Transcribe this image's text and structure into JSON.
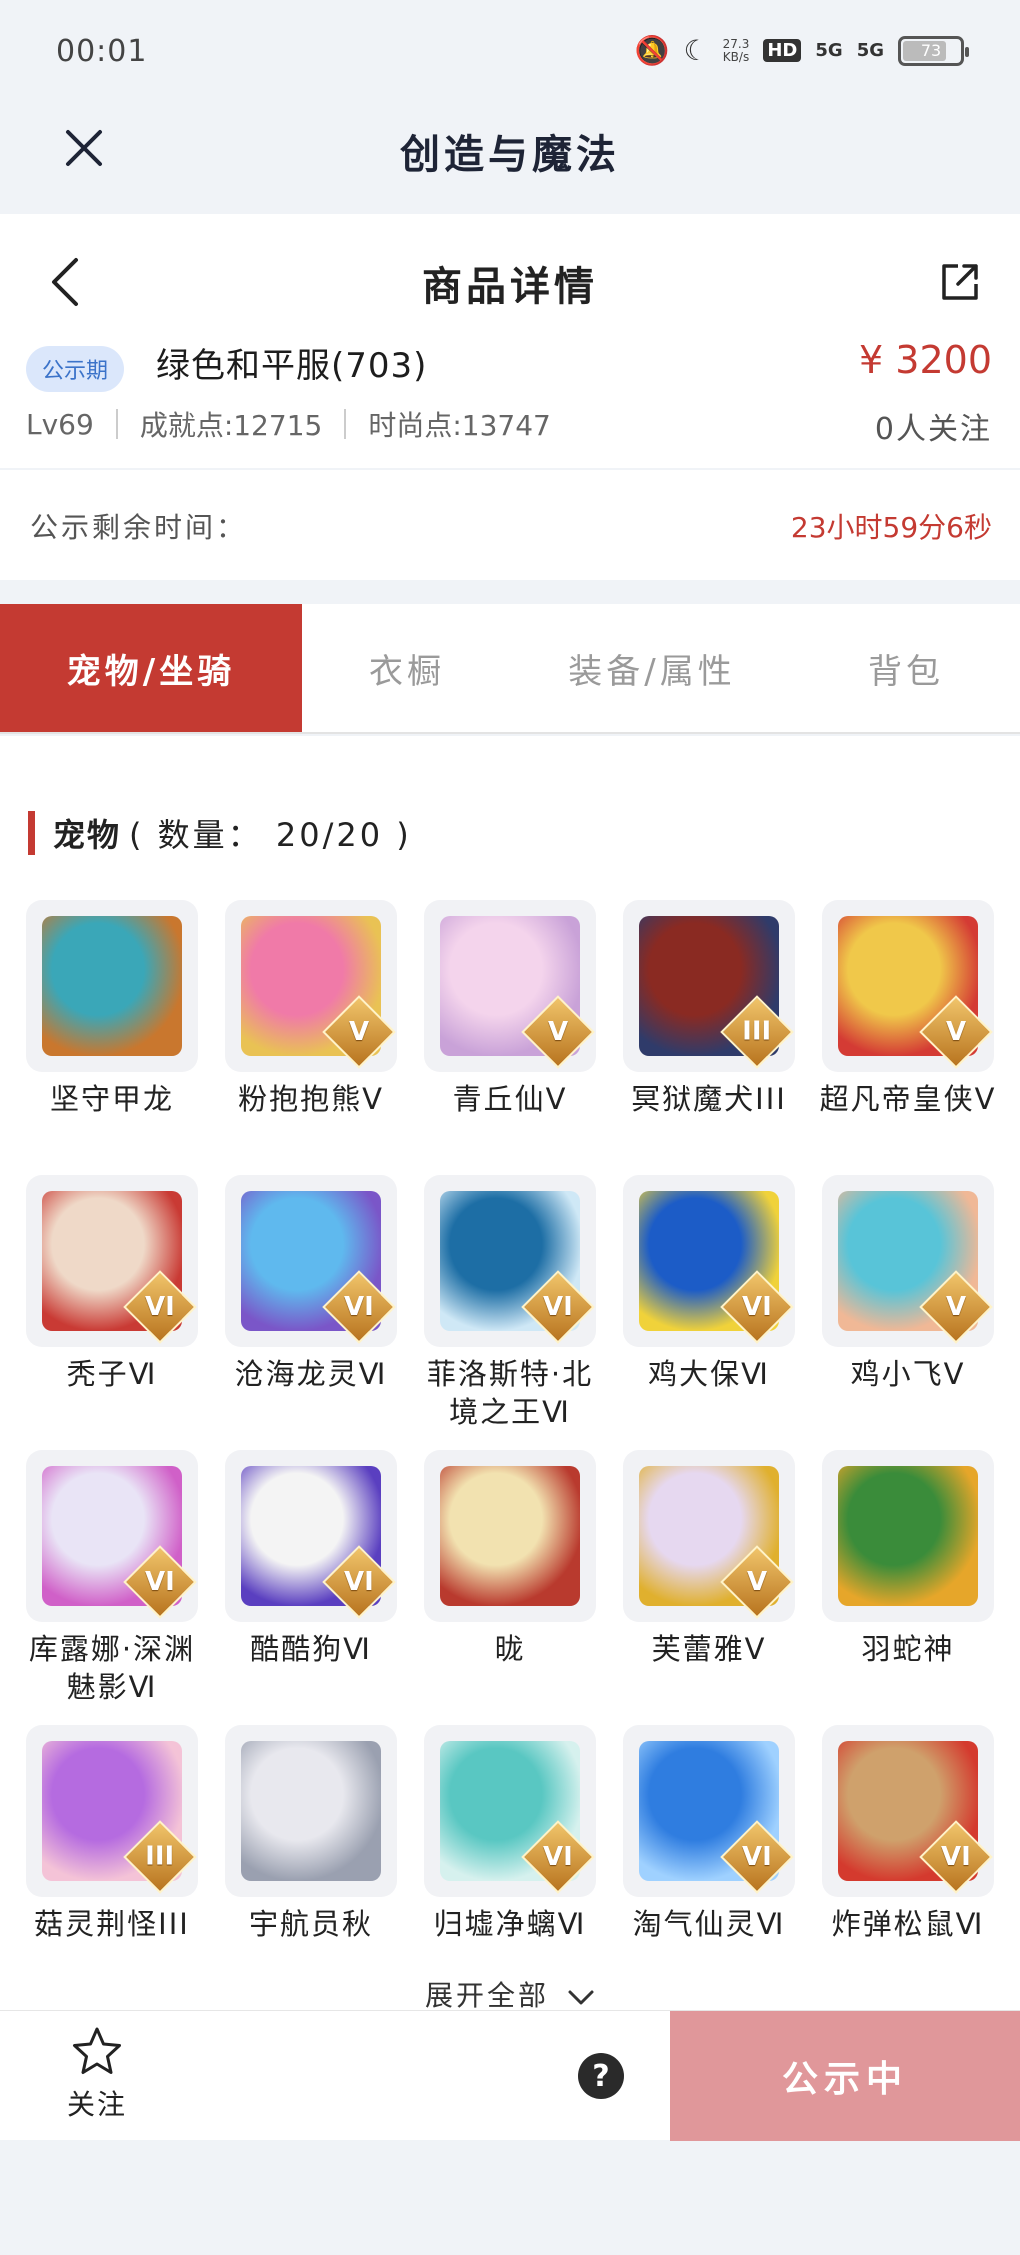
{
  "status_bar": {
    "time": "00:01",
    "net_speed_value": "27.3",
    "net_speed_unit": "KB/s",
    "hd_label": "HD",
    "signal1": "5G",
    "signal2": "5G",
    "battery": "73",
    "icons": [
      "mute-icon",
      "moon-icon"
    ]
  },
  "app_bar": {
    "title": "创造与魔法"
  },
  "nav": {
    "title": "商品详情"
  },
  "product": {
    "badge": "公示期",
    "name": "绿色和平服(703)",
    "price": "¥ 3200",
    "level": "Lv69",
    "achievement": "成就点:12715",
    "fashion": "时尚点:13747",
    "followers": "0人关注"
  },
  "countdown": {
    "label": "公示剩余时间：",
    "value": "23小时59分6秒"
  },
  "tabs": [
    {
      "label": "宠物/坐骑",
      "active": true
    },
    {
      "label": "衣橱",
      "active": false
    },
    {
      "label": "装备/属性",
      "active": false
    },
    {
      "label": "背包",
      "active": false
    }
  ],
  "section": {
    "title": "宠物",
    "count": "( 数量： 20/20 )"
  },
  "pets": [
    {
      "name": "坚守甲龙",
      "grade": "",
      "color1": "#3aa7b8",
      "color2": "#c9772e"
    },
    {
      "name": "粉抱抱熊Ⅴ",
      "grade": "V",
      "color1": "#f07aa8",
      "color2": "#e9c254"
    },
    {
      "name": "青丘仙Ⅴ",
      "grade": "V",
      "color1": "#f4d4ec",
      "color2": "#c9a2d8"
    },
    {
      "name": "冥狱魔犬III",
      "grade": "III",
      "color1": "#8a2a22",
      "color2": "#2f3b6a"
    },
    {
      "name": "超凡帝皇侠Ⅴ",
      "grade": "V",
      "color1": "#f0c84a",
      "color2": "#d43b34"
    },
    {
      "name": "秃子Ⅵ",
      "grade": "VI",
      "color1": "#efd9c8",
      "color2": "#c93a34"
    },
    {
      "name": "沧海龙灵Ⅵ",
      "grade": "VI",
      "color1": "#5fb9ee",
      "color2": "#7a56c8"
    },
    {
      "name": "菲洛斯特·北境之王Ⅵ",
      "grade": "VI",
      "color1": "#1d6ea5",
      "color2": "#cfe8f6"
    },
    {
      "name": "鸡大保Ⅵ",
      "grade": "VI",
      "color1": "#1c5cc7",
      "color2": "#f0d23a"
    },
    {
      "name": "鸡小飞Ⅴ",
      "grade": "V",
      "color1": "#58c4d8",
      "color2": "#f0b896"
    },
    {
      "name": "库露娜·深渊魅影Ⅵ",
      "grade": "VI",
      "color1": "#e9e4f6",
      "color2": "#d060c8"
    },
    {
      "name": "酷酷狗Ⅵ",
      "grade": "VI",
      "color1": "#f4f4f4",
      "color2": "#5a3fc0"
    },
    {
      "name": "昽",
      "grade": "",
      "color1": "#f2e2b0",
      "color2": "#b93a2e"
    },
    {
      "name": "芙蕾雅Ⅴ",
      "grade": "V",
      "color1": "#e6d8f0",
      "color2": "#e0b02e"
    },
    {
      "name": "羽蛇神",
      "grade": "",
      "color1": "#3a8c3a",
      "color2": "#e6a62a"
    },
    {
      "name": "菇灵荆怪III",
      "grade": "III",
      "color1": "#b56be0",
      "color2": "#f4c3d7"
    },
    {
      "name": "宇航员秋",
      "grade": "",
      "color1": "#e8e8ee",
      "color2": "#9aa0b0"
    },
    {
      "name": "归墟净螭Ⅵ",
      "grade": "VI",
      "color1": "#59c7c2",
      "color2": "#d6f1ee"
    },
    {
      "name": "淘气仙灵Ⅵ",
      "grade": "VI",
      "color1": "#2f7de0",
      "color2": "#9fd1ff"
    },
    {
      "name": "炸弹松鼠Ⅵ",
      "grade": "VI",
      "color1": "#cfa16c",
      "color2": "#d43a2e"
    }
  ],
  "expand_label": "展开全部",
  "bottom": {
    "fav_label": "关注",
    "help": "?",
    "cta": "公示中"
  },
  "colors": {
    "accent": "#c43a32",
    "cta": "#e0979a",
    "badge_bg": "#dbe7fb",
    "badge_fg": "#3b73c9"
  }
}
